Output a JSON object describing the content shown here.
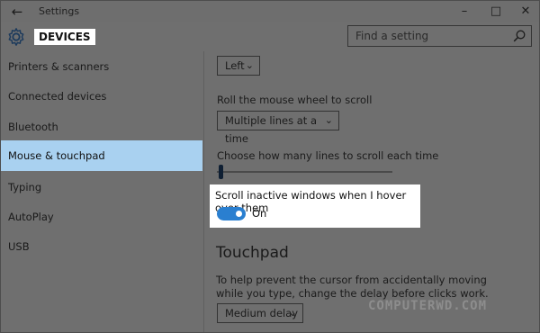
{
  "window": {
    "title": "Settings",
    "back_icon": "arrow-left",
    "controls": {
      "minimize": "–",
      "maximize": "□",
      "close": "✕"
    }
  },
  "header": {
    "heading": "DEVICES",
    "search_placeholder": "Find a setting"
  },
  "sidebar": {
    "items": [
      {
        "label": "Printers & scanners",
        "active": false
      },
      {
        "label": "Connected devices",
        "active": false
      },
      {
        "label": "Bluetooth",
        "active": false
      },
      {
        "label": "Mouse & touchpad",
        "active": true
      },
      {
        "label": "Typing",
        "active": false
      },
      {
        "label": "AutoPlay",
        "active": false
      },
      {
        "label": "USB",
        "active": false
      }
    ]
  },
  "main": {
    "primary_button_dropdown": {
      "value": "Left"
    },
    "scroll_wheel": {
      "label": "Roll the mouse wheel to scroll",
      "value": "Multiple lines at a time"
    },
    "lines_to_scroll": {
      "label": "Choose how many lines to scroll each time",
      "slider_level": 0.02
    },
    "inactive_scroll": {
      "label": "Scroll inactive windows when I hover over them",
      "state": "On",
      "enabled": true
    },
    "touchpad": {
      "section_title": "Touchpad",
      "description": "To help prevent the cursor from accidentally moving while you type, change the delay before clicks work.",
      "delay_value": "Medium delay"
    }
  },
  "watermark": "COMPUTERWD.COM",
  "colors": {
    "accent": "#2a7fd0",
    "selected_nav": "#a9d1f0",
    "overlay_background": "#6f6f6f"
  }
}
